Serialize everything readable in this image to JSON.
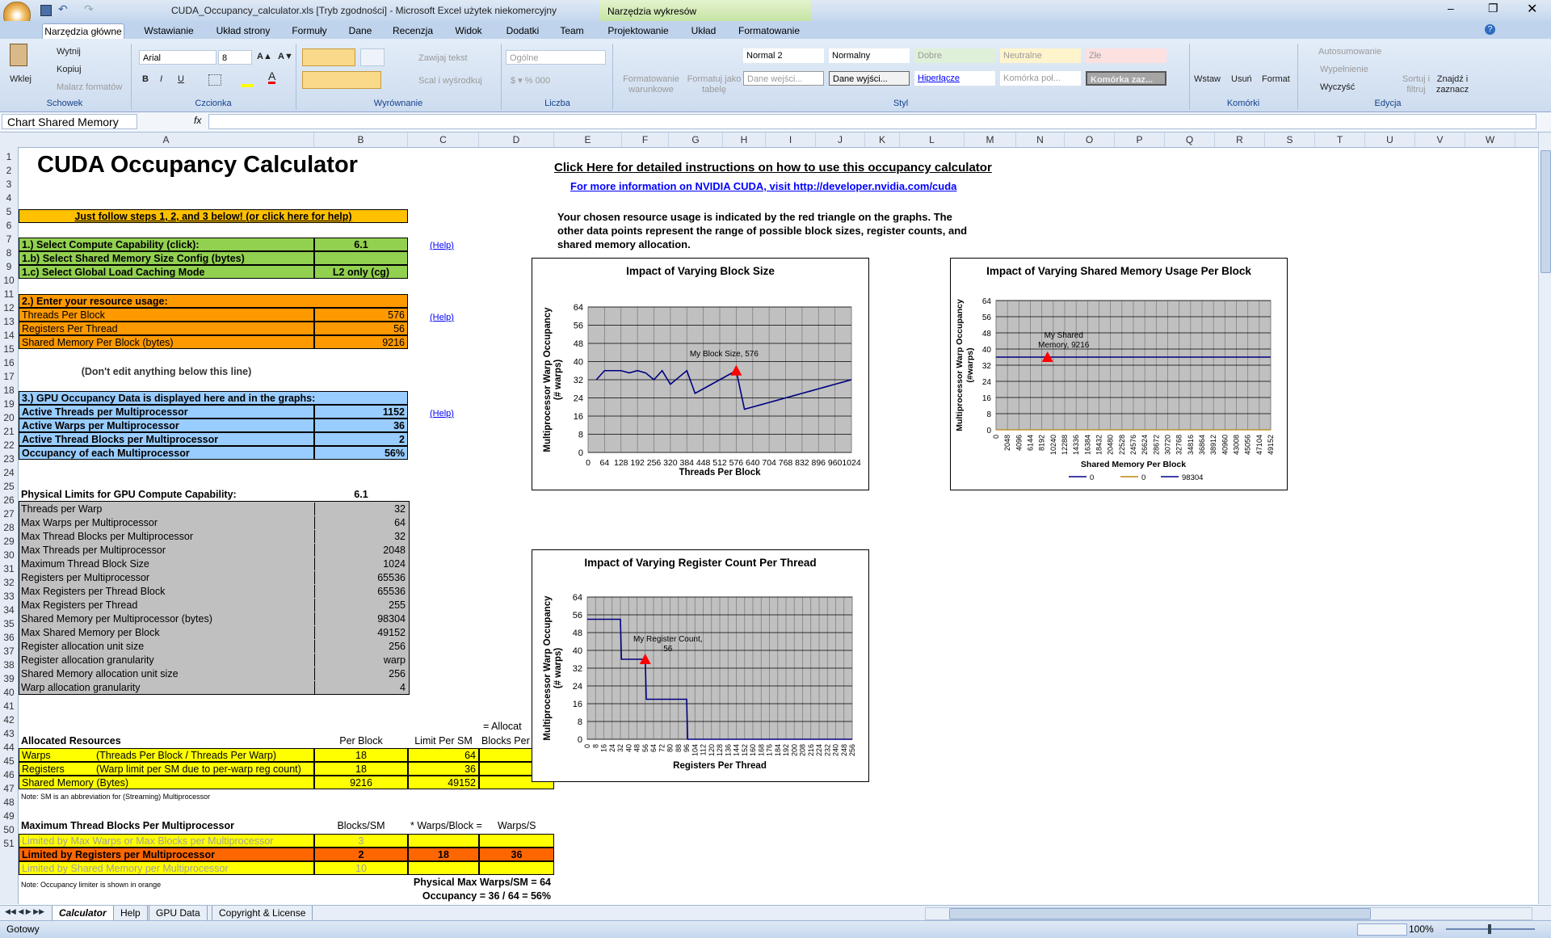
{
  "window": {
    "title": "CUDA_Occupancy_calculator.xls  [Tryb zgodności] - Microsoft Excel użytek niekomercyjny",
    "context_tab": "Narzędzia wykresów"
  },
  "tabs": [
    "Narzędzia główne",
    "Wstawianie",
    "Układ strony",
    "Formuły",
    "Dane",
    "Recenzja",
    "Widok",
    "Dodatki",
    "Team",
    "Projektowanie",
    "Układ",
    "Formatowanie"
  ],
  "ribbon": {
    "clipboard": {
      "paste": "Wklej",
      "cut": "Wytnij",
      "copy": "Kopiuj",
      "painter": "Malarz formatów",
      "label": "Schowek"
    },
    "font": {
      "name": "Arial",
      "size": "8",
      "label": "Czcionka"
    },
    "alignment": {
      "wrap": "Zawijaj tekst",
      "merge": "Scal i wyśrodkuj",
      "label": "Wyrównanie"
    },
    "number": {
      "format": "Ogólne",
      "label": "Liczba"
    },
    "styles": {
      "cond": "Formatowanie warunkowe",
      "table": "Formatuj jako tabelę",
      "label": "Styl",
      "cells": [
        "Normal 2",
        "Normalny",
        "Dobre",
        "Neutralne",
        "Złe",
        "Dane wejści...",
        "Dane wyjści...",
        "Hiperłącze",
        "Komórka poł...",
        "Komórka zaz..."
      ]
    },
    "cells": {
      "insert": "Wstaw",
      "delete": "Usuń",
      "format": "Format",
      "label": "Komórki"
    },
    "editing": {
      "autosum": "Autosumowanie",
      "fill": "Wypełnienie",
      "clear": "Wyczyść",
      "sort": "Sortuj i filtruj",
      "find": "Znajdź i zaznacz",
      "label": "Edycja"
    }
  },
  "formula_bar": {
    "name_box": "Chart Shared Memory",
    "fx": "fx"
  },
  "columns": [
    "A",
    "B",
    "C",
    "D",
    "E",
    "F",
    "G",
    "H",
    "I",
    "J",
    "K",
    "L",
    "M",
    "N",
    "O",
    "P",
    "Q",
    "R",
    "S",
    "T",
    "U",
    "V",
    "W"
  ],
  "rows": [
    "1",
    "2",
    "3",
    "4",
    "5",
    "6",
    "7",
    "8",
    "9",
    "10",
    "11",
    "12",
    "13",
    "14",
    "15",
    "16",
    "17",
    "18",
    "19",
    "20",
    "21",
    "22",
    "23",
    "24",
    "25",
    "26",
    "27",
    "28",
    "29",
    "30",
    "31",
    "32",
    "33",
    "34",
    "35",
    "36",
    "37",
    "38",
    "39",
    "40",
    "41",
    "42",
    "43",
    "44",
    "45",
    "46",
    "47",
    "48",
    "49",
    "50",
    "51"
  ],
  "sheet": {
    "title": "CUDA Occupancy Calculator",
    "click_here": "Click Here for detailed instructions on how to use this occupancy calculator",
    "more_info": "For more information on NVIDIA CUDA, visit http://developer.nvidia.com/cuda",
    "desc1": "Your chosen resource usage is indicated by the red triangle on the graphs.  The",
    "desc2": "other data points represent the range of possible block sizes, register counts, and",
    "desc3": "shared memory allocation.",
    "steps": "Just follow steps 1, 2, and 3 below! (or click here for help)",
    "s1": "1.) Select Compute Capability (click):",
    "s1v": "6.1",
    "s1b": "1.b) Select Shared Memory Size Config (bytes)",
    "s1c": "1.c) Select Global Load Caching Mode",
    "s1cv": "L2 only (cg)",
    "help": "(Help)",
    "s2": "2.) Enter your resource usage:",
    "tpb": "Threads Per Block",
    "tpbv": "576",
    "rpt": "Registers Per Thread",
    "rptv": "56",
    "smpb": "Shared Memory Per Block (bytes)",
    "smpbv": "9216",
    "dont": "(Don't edit anything below this line)",
    "s3": "3.) GPU Occupancy Data is displayed here and in the graphs:",
    "o1": "Active Threads per Multiprocessor",
    "o1v": "1152",
    "o2": "Active Warps per Multiprocessor",
    "o2v": "36",
    "o3": "Active Thread Blocks per Multiprocessor",
    "o3v": "2",
    "o4": "Occupancy of each Multiprocessor",
    "o4v": "56%",
    "phys": "Physical Limits for GPU Compute Capability:",
    "physv": "6.1",
    "limits": [
      [
        "Threads per Warp",
        "32"
      ],
      [
        "Max Warps per Multiprocessor",
        "64"
      ],
      [
        "Max Thread Blocks per Multiprocessor",
        "32"
      ],
      [
        "Max Threads per Multiprocessor",
        "2048"
      ],
      [
        "Maximum Thread Block Size",
        "1024"
      ],
      [
        "Registers per Multiprocessor",
        "65536"
      ],
      [
        "Max Registers per Thread Block",
        "65536"
      ],
      [
        "Max Registers per Thread",
        "255"
      ],
      [
        "Shared Memory per Multiprocessor (bytes)",
        "98304"
      ],
      [
        "Max Shared Memory per Block",
        "49152"
      ],
      [
        "Register allocation unit size",
        "256"
      ],
      [
        "Register allocation granularity",
        "warp"
      ],
      [
        "Shared Memory allocation unit size",
        "256"
      ],
      [
        "Warp allocation granularity",
        "4"
      ]
    ],
    "alloc_hdr": "= Allocat",
    "alloc": "Allocated Resources",
    "perblock": "Per Block",
    "limitsm": "Limit Per SM",
    "blocksper": "Blocks Per",
    "warps": "Warps",
    "warps_d": "(Threads Per Block / Threads Per Warp)",
    "warps_pb": "18",
    "warps_l": "64",
    "regs": "Registers",
    "regs_d": "(Warp limit per SM due to per-warp reg count)",
    "regs_pb": "18",
    "regs_l": "36",
    "smem": "Shared Memory (Bytes)",
    "smem_pb": "9216",
    "smem_l": "49152",
    "note1": "Note: SM is an abbreviation for (Streaming) Multiprocessor",
    "maxtb": "Maximum Thread Blocks Per Multiprocessor",
    "blocksm": "Blocks/SM",
    "wpb": "* Warps/Block =",
    "wps": "Warps/S",
    "lim1": "Limited by Max Warps or Max Blocks per Multiprocessor",
    "lim1v": "3",
    "lim2": "Limited by Registers per Multiprocessor",
    "lim2v": "2",
    "lim2w": "18",
    "lim2s": "36",
    "lim3": "Limited by Shared Memory per Multiprocessor",
    "lim3v": "10",
    "note2": "Note: Occupancy limiter is shown in orange",
    "pmax": "Physical Max Warps/SM = 64",
    "occ": "Occupancy = 36 / 64 = 56%"
  },
  "chart_data": [
    {
      "type": "line",
      "title": "Impact of Varying Block Size",
      "xlabel": "Threads Per Block",
      "ylabel": "Multiprocessor Warp Occupancy (# warps)",
      "xlim": [
        0,
        1024
      ],
      "ylim": [
        0,
        64
      ],
      "x": [
        32,
        64,
        96,
        128,
        160,
        192,
        224,
        256,
        288,
        320,
        352,
        384,
        416,
        448,
        480,
        512,
        544,
        576,
        608,
        640,
        672,
        704,
        736,
        768,
        800,
        832,
        864,
        896,
        928,
        960,
        992,
        1024
      ],
      "values": [
        32,
        36,
        36,
        36,
        35,
        36,
        35,
        32,
        36,
        30,
        33,
        36,
        26,
        28,
        30,
        32,
        34,
        36,
        19,
        20,
        21,
        22,
        23,
        24,
        25,
        26,
        27,
        28,
        29,
        30,
        31,
        32
      ],
      "marker": {
        "x": 576,
        "y": 36,
        "label": "My Block Size, 576"
      },
      "xticks": [
        "0",
        "64",
        "128",
        "192",
        "256",
        "320",
        "384",
        "448",
        "512",
        "576",
        "640",
        "704",
        "768",
        "832",
        "896",
        "960",
        "1024"
      ],
      "yticks": [
        "0",
        "8",
        "16",
        "24",
        "32",
        "40",
        "48",
        "56",
        "64"
      ]
    },
    {
      "type": "line",
      "title": "Impact of Varying Shared Memory Usage Per Block",
      "xlabel": "Shared Memory Per Block",
      "ylabel": "Multiprocessor Warp Occupancy (#warps)",
      "xlim": [
        0,
        49152
      ],
      "ylim": [
        0,
        64
      ],
      "series": [
        {
          "name": "0",
          "color": "#00008b"
        },
        {
          "name": "0",
          "color": "#b8860b"
        },
        {
          "name": "98304",
          "color": "#00008b"
        }
      ],
      "values": [
        36,
        36
      ],
      "marker": {
        "x": 9216,
        "y": 36,
        "label": "My Shared Memory, 9216"
      },
      "xticks": [
        "0",
        "2048",
        "4096",
        "6144",
        "8192",
        "10240",
        "12288",
        "14336",
        "16384",
        "18432",
        "20480",
        "22528",
        "24576",
        "26624",
        "28672",
        "30720",
        "32768",
        "34816",
        "36864",
        "38912",
        "40960",
        "43008",
        "45056",
        "47104",
        "49152"
      ],
      "yticks": [
        "0",
        "8",
        "16",
        "24",
        "32",
        "40",
        "48",
        "56",
        "64"
      ]
    },
    {
      "type": "line",
      "title": "Impact of Varying Register Count Per Thread",
      "xlabel": "Registers Per Thread",
      "ylabel": "Multiprocessor Warp Occupancy (# warps)",
      "xlim": [
        0,
        256
      ],
      "ylim": [
        0,
        64
      ],
      "x": [
        0,
        32,
        33,
        56,
        57,
        96,
        97,
        256
      ],
      "values": [
        54,
        54,
        36,
        36,
        18,
        18,
        0,
        0
      ],
      "marker": {
        "x": 56,
        "y": 36,
        "label": "My Register Count, 56"
      },
      "xticks": [
        "0",
        "8",
        "16",
        "24",
        "32",
        "40",
        "48",
        "56",
        "64",
        "72",
        "80",
        "88",
        "96",
        "104",
        "112",
        "120",
        "128",
        "136",
        "144",
        "152",
        "160",
        "168",
        "176",
        "184",
        "192",
        "200",
        "208",
        "216",
        "224",
        "232",
        "240",
        "248",
        "256"
      ],
      "yticks": [
        "0",
        "8",
        "16",
        "24",
        "32",
        "40",
        "48",
        "56",
        "64"
      ]
    }
  ],
  "sheet_tabs": [
    "Calculator",
    "Help",
    "GPU Data",
    "Copyright & License"
  ],
  "status": {
    "ready": "Gotowy",
    "zoom": "100%"
  }
}
